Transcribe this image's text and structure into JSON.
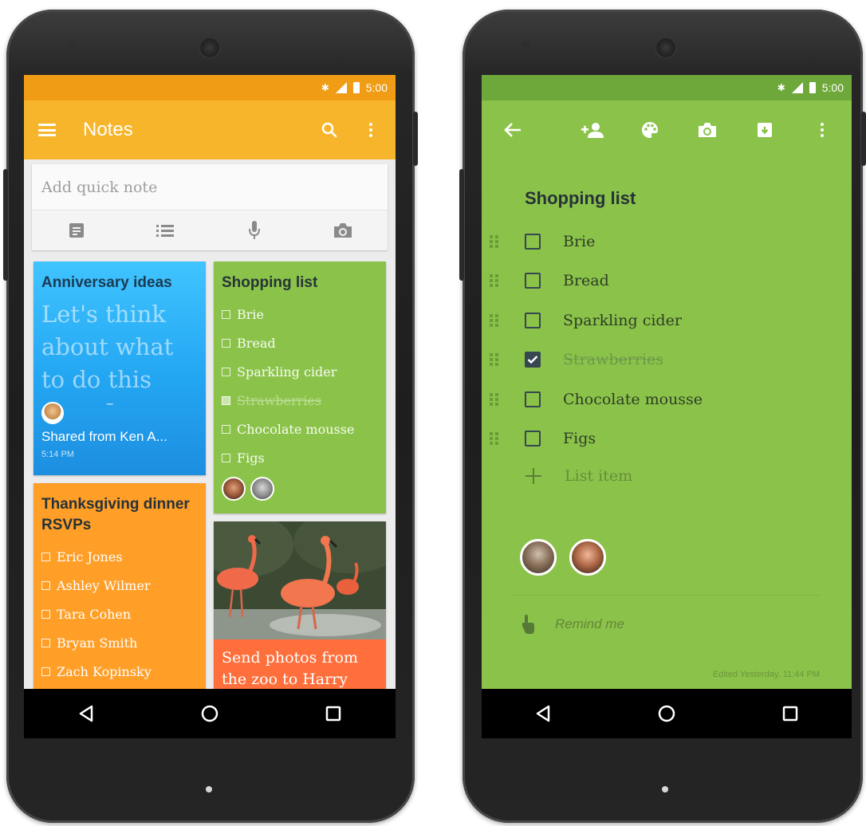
{
  "left_phone": {
    "status": {
      "time": "5:00"
    },
    "appbar": {
      "title": "Notes"
    },
    "quick_note": {
      "placeholder": "Add quick note"
    },
    "cards": {
      "anniversary": {
        "title": "Anniversary ideas",
        "body": "Let's think about what to do this year. Love",
        "shared": "Shared from Ken A...",
        "time": "5:14 PM"
      },
      "shopping": {
        "title": "Shopping list",
        "items": [
          "Brie",
          "Bread",
          "Sparkling cider",
          "Strawberries",
          "Chocolate mousse",
          "Figs"
        ]
      },
      "thanksgiving": {
        "title": "Thanksgiving dinner RSVPs",
        "items": [
          "Eric Jones",
          "Ashley Wilmer",
          "Tara Cohen",
          "Bryan Smith",
          "Zach Kopinsky"
        ]
      },
      "zoo": {
        "text": "Send photos from the zoo to Harry"
      }
    },
    "colors": {
      "status": "#f09d15",
      "appbar": "#f7b52b",
      "blue": "#2196f3",
      "green": "#8bc34a",
      "orange": "#ff9f28",
      "coral": "#ff6f3c"
    }
  },
  "right_phone": {
    "status": {
      "time": "5:00"
    },
    "note": {
      "title": "Shopping list",
      "items": [
        {
          "text": "Brie",
          "checked": false
        },
        {
          "text": "Bread",
          "checked": false
        },
        {
          "text": "Sparkling cider",
          "checked": false
        },
        {
          "text": "Strawberries",
          "checked": true
        },
        {
          "text": "Chocolate mousse",
          "checked": false
        },
        {
          "text": "Figs",
          "checked": false
        }
      ],
      "add_item": "List item",
      "remind": "Remind me",
      "edited": "Edited Yesterday, 11:44 PM"
    },
    "toolbar_icons": [
      "back-arrow-icon",
      "add-person-icon",
      "palette-icon",
      "camera-icon",
      "archive-icon",
      "more-vert-icon"
    ],
    "colors": {
      "status": "#6fa83a",
      "background": "#8bc34a"
    }
  }
}
